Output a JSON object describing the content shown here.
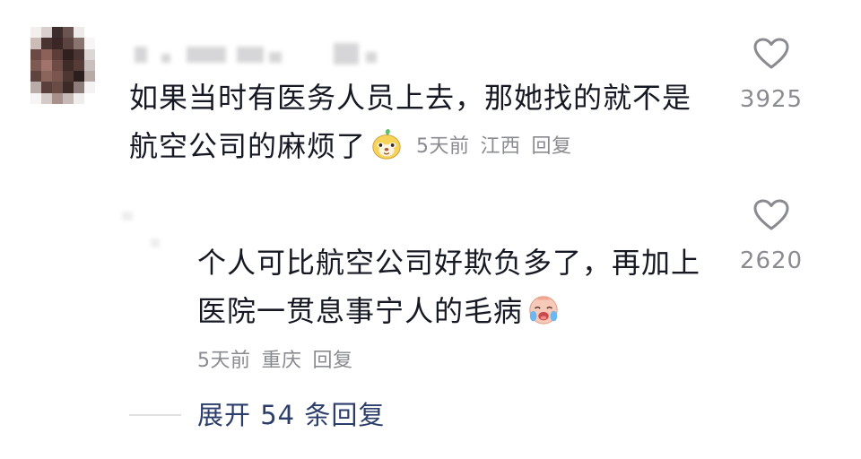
{
  "comment": {
    "text_line1": "如果当时有医务人员上去，那她找的就不是",
    "text_line2": "航空公司的麻烦了",
    "emoji_icon": "cute-face-emoji",
    "time": "5天前",
    "location": "江西",
    "reply_label": "回复",
    "like_count": "3925"
  },
  "reply": {
    "text_line1": "个人可比航空公司好欺负多了，再加上",
    "text_line2": "医院一贯息事宁人的毛病",
    "emoji_icon": "crying-face-emoji",
    "time": "5天前",
    "location": "重庆",
    "reply_label": "回复",
    "like_count": "2620"
  },
  "expand": {
    "label": "展开 54 条回复"
  },
  "colors": {
    "primary_text": "#161823",
    "secondary_text": "#8a8b91",
    "expand_link": "#2b3d6b",
    "heart_outline": "#8a8b91"
  }
}
